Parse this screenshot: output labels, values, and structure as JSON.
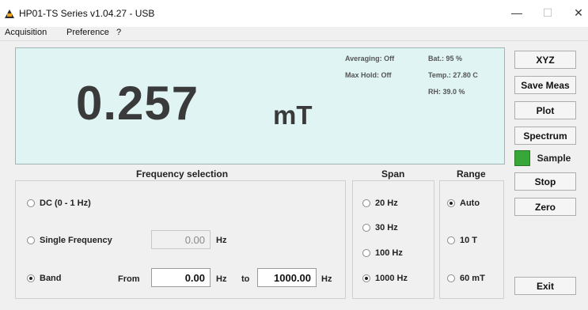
{
  "window": {
    "title": "HP01-TS Series v1.04.27 - USB",
    "minimize_glyph": "—",
    "maximize_glyph": "☐",
    "close_glyph": "✕"
  },
  "menu": {
    "items": [
      "Acquisition",
      "Preference",
      "?"
    ]
  },
  "display": {
    "value": "0.257",
    "unit": "mT",
    "averaging": "Averaging: Off",
    "max_hold": "Max Hold: Off",
    "battery": "Bat.: 95 %",
    "temperature": "Temp.: 27.80 C",
    "humidity": "RH: 39.0 %"
  },
  "buttons": {
    "xyz": "XYZ",
    "save_meas": "Save Meas",
    "plot": "Plot",
    "spectrum": "Spectrum",
    "sample": "Sample",
    "stop": "Stop",
    "zero": "Zero",
    "exit": "Exit"
  },
  "frequency": {
    "title": "Frequency selection",
    "dc_label": "DC (0 - 1 Hz)",
    "single_label": "Single Frequency",
    "single_value": "0.00",
    "single_unit": "Hz",
    "band_label": "Band",
    "from_label": "From",
    "from_value": "0.00",
    "from_unit": "Hz",
    "to_label": "to",
    "to_value": "1000.00",
    "to_unit": "Hz",
    "selected": "Band"
  },
  "span": {
    "title": "Span",
    "options": [
      "20 Hz",
      "30 Hz",
      "100 Hz",
      "1000 Hz"
    ],
    "selected": "1000 Hz"
  },
  "range": {
    "title": "Range",
    "options": [
      "Auto",
      "10 T",
      "60 mT"
    ],
    "selected": "Auto"
  },
  "colors": {
    "display_bg": "#e0f4f4",
    "sample_led": "#37a837"
  }
}
